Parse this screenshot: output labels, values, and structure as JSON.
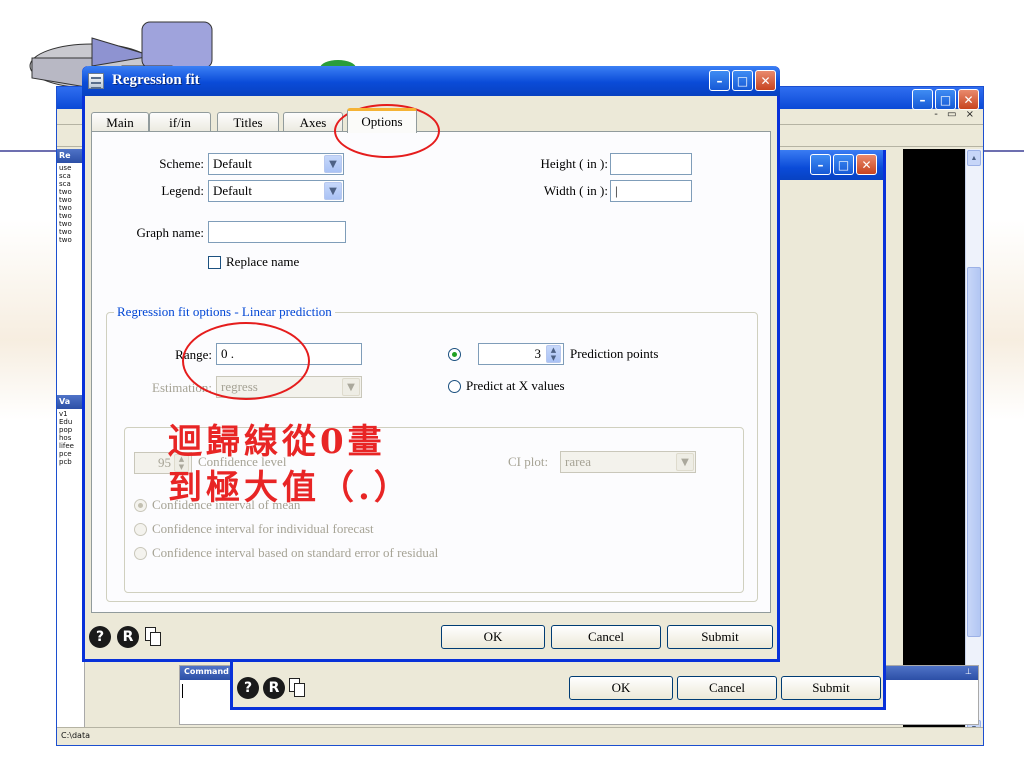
{
  "dialog": {
    "title": "Regression fit",
    "tabs": [
      "Main",
      "if/in",
      "Titles",
      "Axes",
      "Options"
    ],
    "active_tab": "Options",
    "scheme_label": "Scheme:",
    "scheme_value": "Default",
    "legend_label": "Legend:",
    "legend_value": "Default",
    "graph_name_label": "Graph name:",
    "graph_name_value": "",
    "replace_name_label": "Replace name",
    "height_label": "Height ( in ):",
    "height_value": "",
    "width_label": "Width ( in ):",
    "width_value": "|",
    "group_title": "Regression fit options - Linear prediction",
    "range_label": "Range:",
    "range_value": "0 .",
    "estimation_label": "Estimation:",
    "estimation_value": "regress",
    "prediction_points_value": "3",
    "prediction_points_label": "Prediction points",
    "predict_at_x_label": "Predict at X values",
    "confidence_level_value": "95",
    "confidence_level_label": "Confidence level",
    "ci_plot_label": "CI plot:",
    "ci_plot_value": "rarea",
    "ci_mean_label": "Confidence interval of mean",
    "ci_forecast_label": "Confidence interval for individual forecast",
    "ci_residual_label": "Confidence interval based on standard error of residual",
    "ok_label": "OK",
    "cancel_label": "Cancel",
    "submit_label": "Submit"
  },
  "back_dialog": {
    "ok_label": "OK",
    "cancel_label": "Cancel",
    "submit_label": "Submit"
  },
  "stata": {
    "review_header": "Re",
    "review_items": [
      "use",
      "sca",
      "sca",
      "two",
      "two",
      "two",
      "two",
      "two",
      "two",
      "two"
    ],
    "variables_header": "Va",
    "variable_items": [
      "v1",
      "Edu",
      "pop",
      "hos",
      "lifee",
      "pce",
      "pcb"
    ],
    "command_header": "Command",
    "status_path": "C:\\data"
  },
  "annotation": {
    "line1": "迴歸線從0畫",
    "line2": "到極大值（.）"
  },
  "colors": {
    "title_bar": "#0a4bd8",
    "annotation_red": "#e51d1d",
    "dialog_face": "#ece9d8",
    "slide_rule": "#6d6fb0"
  }
}
